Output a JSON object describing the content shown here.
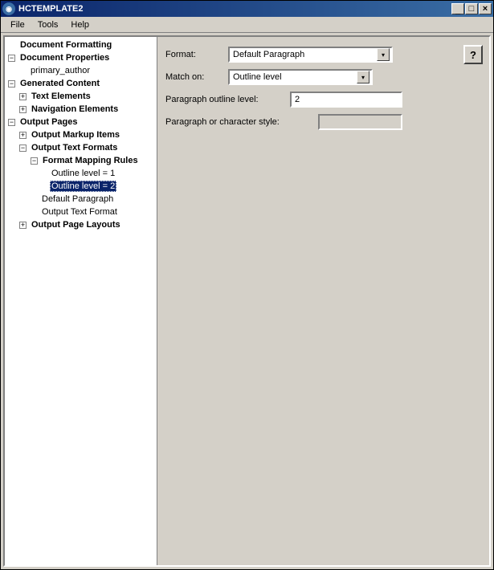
{
  "window": {
    "title": "HCTEMPLATE2",
    "min_glyph": "_",
    "max_glyph": "□",
    "close_glyph": "×"
  },
  "menubar": {
    "file": "File",
    "tools": "Tools",
    "help": "Help"
  },
  "tree": {
    "doc_formatting": "Document Formatting",
    "doc_properties": "Document Properties",
    "primary_author": "primary_author",
    "generated_content": "Generated Content",
    "text_elements": "Text Elements",
    "nav_elements": "Navigation Elements",
    "output_pages": "Output Pages",
    "output_markup_items": "Output Markup Items",
    "output_text_formats": "Output Text Formats",
    "format_mapping_rules": "Format Mapping Rules",
    "outline_level_1": "Outline level = 1",
    "outline_level_2": "Outline level = 2",
    "default_paragraph": "Default Paragraph",
    "output_text_format": "Output Text Format",
    "output_page_layouts": "Output Page Layouts"
  },
  "form": {
    "format_label": "Format:",
    "format_value": "Default Paragraph",
    "match_label": "Match on:",
    "match_value": "Outline level",
    "outline_label": "Paragraph outline level:",
    "outline_value": "2",
    "style_label": "Paragraph or character style:",
    "style_value": "",
    "help_glyph": "?"
  }
}
